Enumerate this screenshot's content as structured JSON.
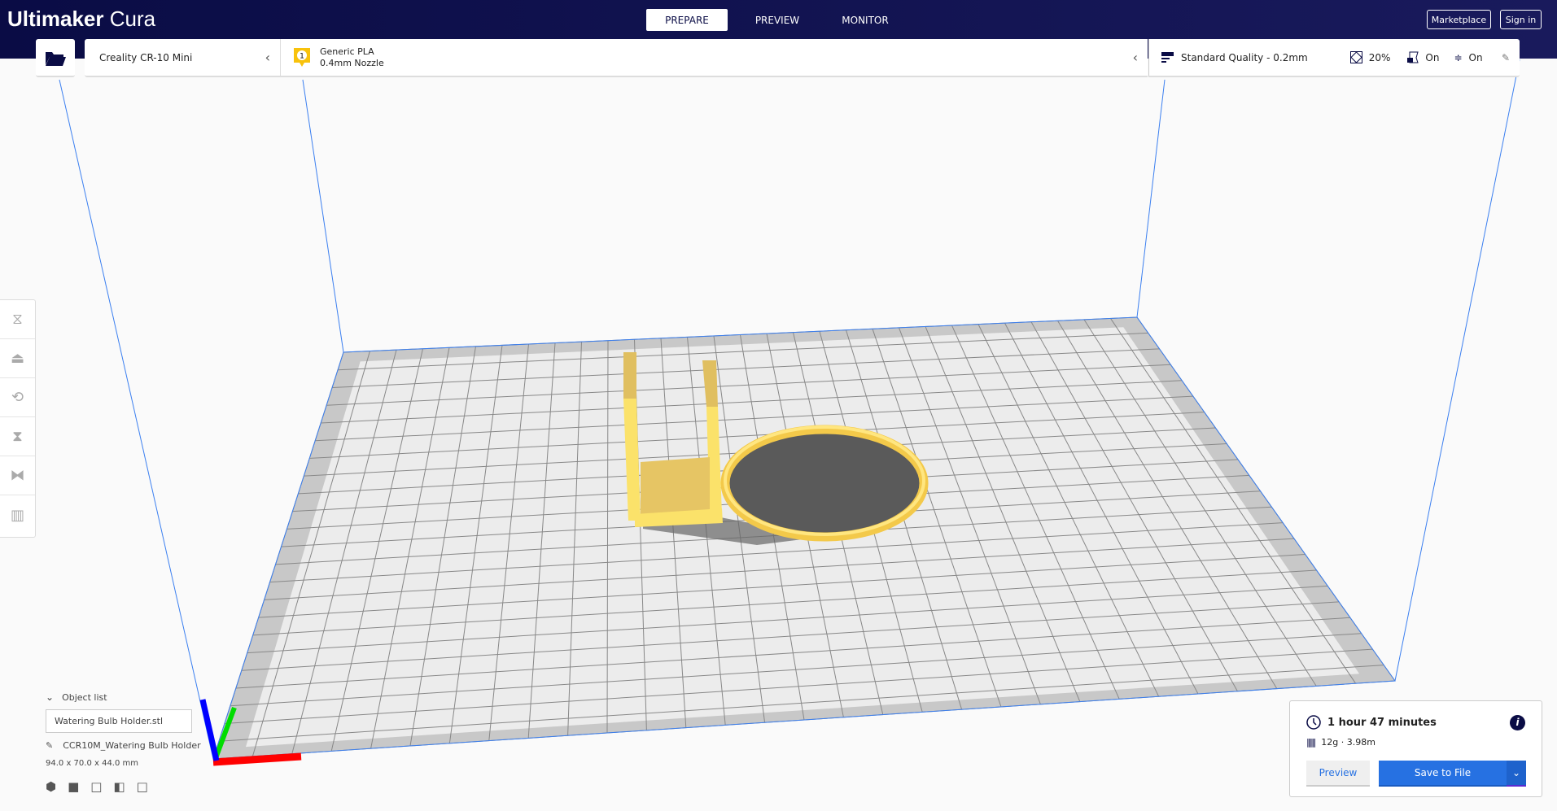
{
  "header": {
    "logo_bold": "Ultimaker",
    "logo_light": "Cura",
    "stages": [
      "PREPARE",
      "PREVIEW",
      "MONITOR"
    ],
    "active_stage": "PREPARE",
    "marketplace": "Marketplace",
    "sign_in": "Sign in"
  },
  "printer": {
    "name": "Creality CR-10 Mini"
  },
  "material": {
    "extruder": "1",
    "name": "Generic PLA",
    "nozzle": "0.4mm Nozzle",
    "badge_color": "#f8c20c"
  },
  "print_settings": {
    "profile": "Standard Quality - 0.2mm",
    "infill": "20%",
    "support": "On",
    "adhesion": "On"
  },
  "tools": [
    "translate-icon",
    "scale-icon",
    "rotate-icon",
    "mirror-icon",
    "per-model-settings-icon",
    "support-blocker-icon"
  ],
  "object_list": {
    "title": "Object list",
    "file": "Watering Bulb Holder.stl",
    "job_name": "CCR10M_Watering Bulb Holder",
    "dimensions": "94.0 x 70.0 x 44.0 mm",
    "views": [
      "3d-view-icon",
      "front-view-icon",
      "top-view-icon",
      "left-view-icon",
      "right-view-icon"
    ]
  },
  "job": {
    "time": "1 hour 47 minutes",
    "material_usage": "12g · 3.98m",
    "preview": "Preview",
    "save": "Save to File",
    "accent": "#2671e2"
  },
  "colors": {
    "header": "#0a0c45",
    "model": "#f5d85a",
    "axis_x": "#ff0000",
    "axis_y": "#00dd00",
    "axis_z": "#0000ff",
    "volume_lines": "#3b7ff0"
  }
}
